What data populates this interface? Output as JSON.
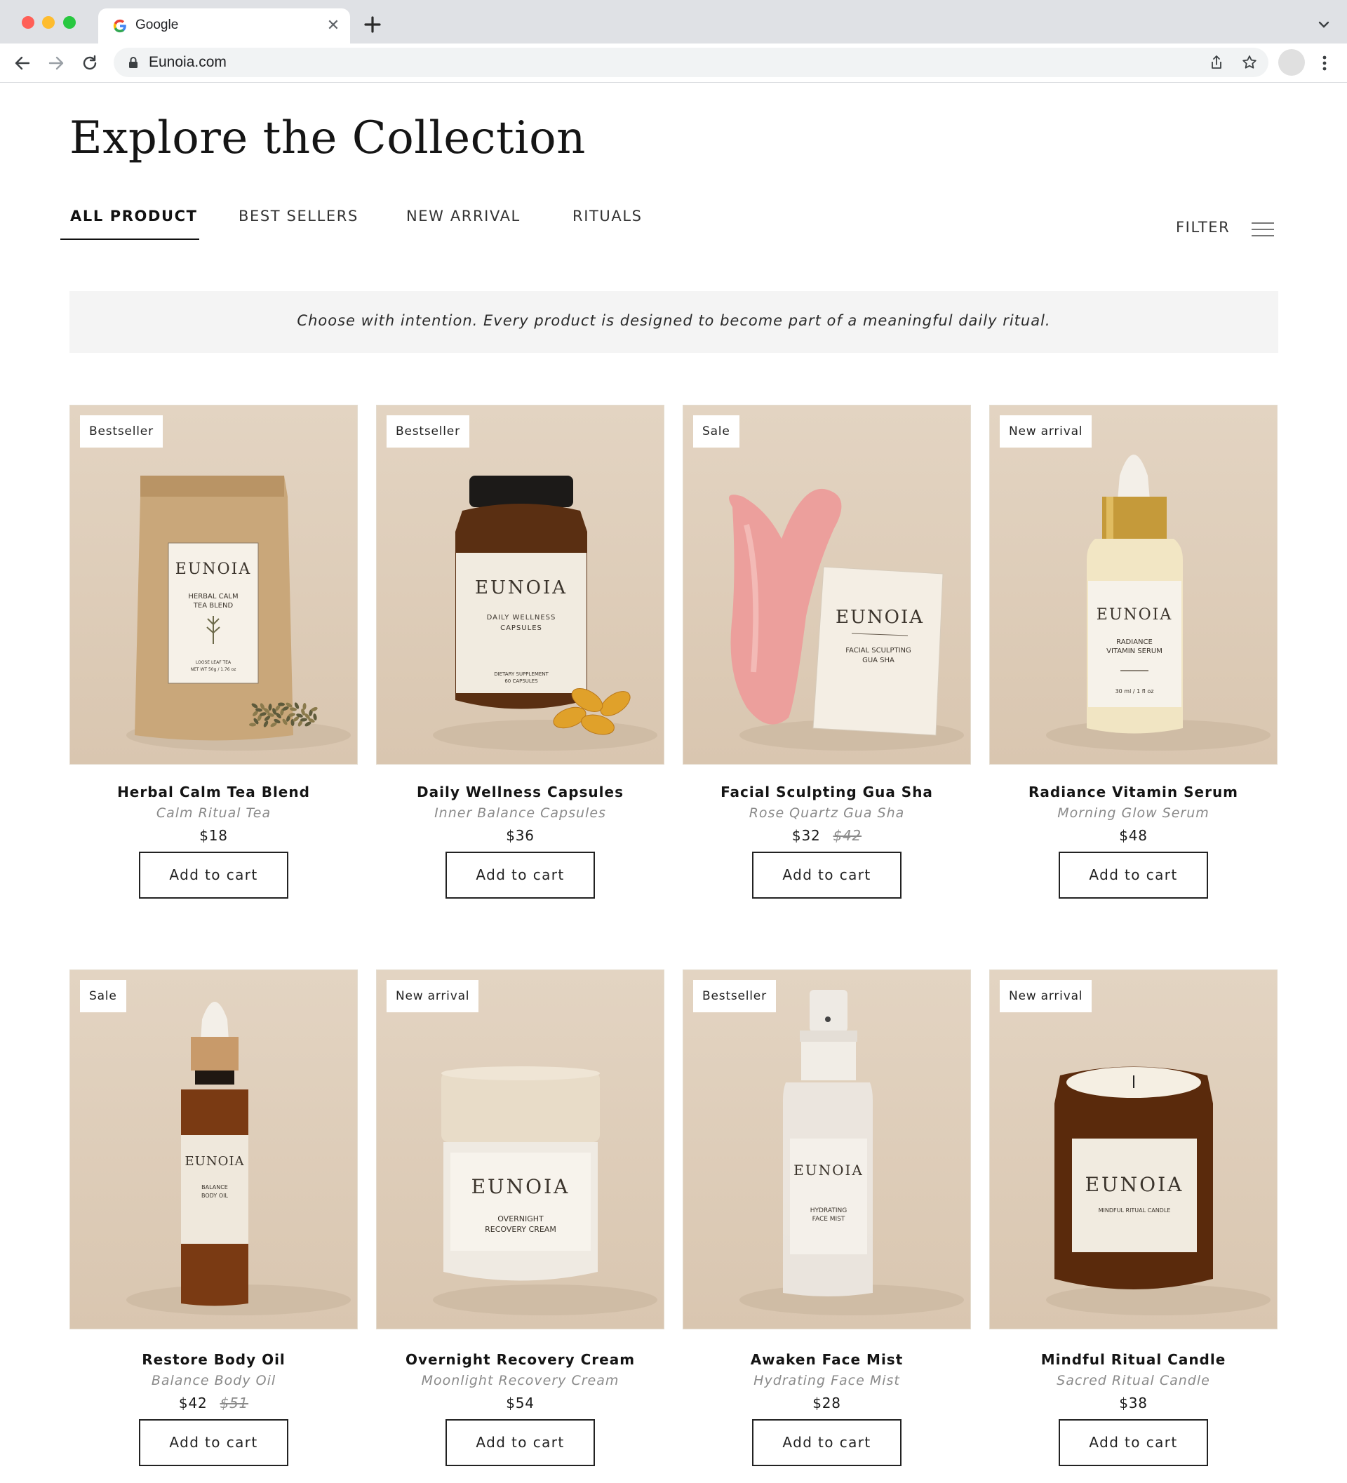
{
  "browser": {
    "tab_title": "Google",
    "tab_close": "✕",
    "url": "Eunoia.com"
  },
  "page": {
    "title": "Explore the Collection",
    "tabs": [
      {
        "label": "ALL PRODUCT",
        "active": true
      },
      {
        "label": "BEST SELLERS",
        "active": false
      },
      {
        "label": "NEW ARRIVAL",
        "active": false
      },
      {
        "label": "RITUALS",
        "active": false
      }
    ],
    "filter_label": "FILTER",
    "banner": "Choose with intention. Every product is designed to become part of a meaningful daily ritual."
  },
  "colors": {
    "accent": "#111111",
    "product_background": "#e2d2bf",
    "banner_background": "#f4f4f4"
  },
  "products": [
    {
      "badge": "Bestseller",
      "name": "Herbal Calm Tea Blend",
      "subtitle": "Calm Ritual Tea",
      "price": "$18",
      "old_price": "",
      "button": "Add to cart",
      "image": {
        "kind": "pouch",
        "brand": "EUNOIA",
        "label_line1": "HERBAL CALM",
        "label_line2": "TEA BLEND",
        "fine_print1": "LOOSE LEAF TEA",
        "fine_print2": "NET WT 50g / 1.76 oz"
      }
    },
    {
      "badge": "Bestseller",
      "name": "Daily Wellness Capsules",
      "subtitle": "Inner Balance Capsules",
      "price": "$36",
      "old_price": "",
      "button": "Add to cart",
      "image": {
        "kind": "capsule-jar",
        "brand": "EUNOIA",
        "label_line1": "DAILY WELLNESS",
        "label_line2": "CAPSULES",
        "fine_print1": "DIETARY SUPPLEMENT",
        "fine_print2": "60 CAPSULES"
      }
    },
    {
      "badge": "Sale",
      "name": "Facial Sculpting Gua Sha",
      "subtitle": "Rose Quartz Gua Sha",
      "price": "$32",
      "old_price": "$42",
      "button": "Add to cart",
      "image": {
        "kind": "gua-sha",
        "brand": "EUNOIA",
        "label_line1": "FACIAL SCULPTING",
        "label_line2": "GUA SHA"
      }
    },
    {
      "badge": "New arrival",
      "name": "Radiance Vitamin Serum",
      "subtitle": "Morning Glow Serum",
      "price": "$48",
      "old_price": "",
      "button": "Add to cart",
      "image": {
        "kind": "serum",
        "brand": "EUNOIA",
        "label_line1": "RADIANCE",
        "label_line2": "VITAMIN SERUM",
        "fine_print1": "30 ml / 1 fl oz"
      }
    },
    {
      "badge": "Sale",
      "name": "Restore Body Oil",
      "subtitle": "Balance Body Oil",
      "price": "$42",
      "old_price": "$51",
      "button": "Add to cart",
      "image": {
        "kind": "dropper-oil",
        "brand": "EUNOIA",
        "label_line1": "BALANCE",
        "label_line2": "BODY OIL"
      }
    },
    {
      "badge": "New arrival",
      "name": "Overnight Recovery Cream",
      "subtitle": "Moonlight Recovery Cream",
      "price": "$54",
      "old_price": "",
      "button": "Add to cart",
      "image": {
        "kind": "cream-jar",
        "brand": "EUNOIA",
        "label_line1": "OVERNIGHT",
        "label_line2": "RECOVERY CREAM"
      }
    },
    {
      "badge": "Bestseller",
      "name": "Awaken Face Mist",
      "subtitle": "Hydrating Face Mist",
      "price": "$28",
      "old_price": "",
      "button": "Add to cart",
      "image": {
        "kind": "mist",
        "brand": "EUNOIA",
        "label_line1": "HYDRATING",
        "label_line2": "FACE MIST"
      }
    },
    {
      "badge": "New arrival",
      "name": "Mindful Ritual Candle",
      "subtitle": "Sacred Ritual Candle",
      "price": "$38",
      "old_price": "",
      "button": "Add to cart",
      "image": {
        "kind": "candle",
        "brand": "EUNOIA",
        "label_line1": "MINDFUL RITUAL CANDLE"
      }
    }
  ]
}
